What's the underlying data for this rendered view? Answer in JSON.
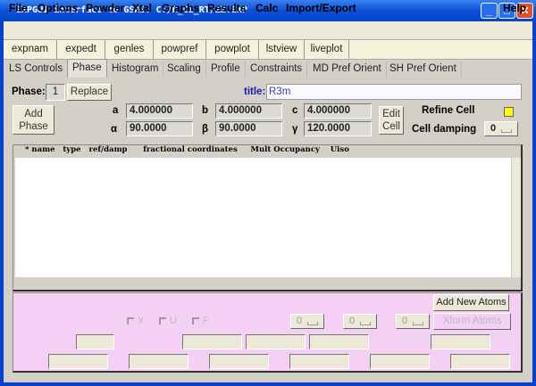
{
  "window": {
    "title": "EXPGUI interface to GSAS: C:/R_C1_RT/ZZ.EXP"
  },
  "menu": [
    "File",
    "Options",
    "Powder",
    "Xtal",
    "Graphs",
    "Results",
    "Calc",
    "Import/Export"
  ],
  "menu_help": "Help",
  "toolbar": [
    "expnam",
    "expedt",
    "genles",
    "powpref",
    "powplot",
    "lstview",
    "liveplot"
  ],
  "tabs": [
    "LS Controls",
    "Phase",
    "Histogram",
    "Scaling",
    "Profile",
    "Constraints",
    "MD Pref Orient",
    "SH Pref Orient"
  ],
  "phase": {
    "label": "Phase:",
    "number": "1",
    "replace": "Replace",
    "title_label": "title:",
    "title_value": "R3m",
    "add_phase": "Add Phase",
    "edit_cell": "Edit Cell",
    "a_label": "a",
    "a": "4.000000",
    "b_label": "b",
    "b": "4.000000",
    "c_label": "c",
    "c": "4.000000",
    "alpha_label": "α",
    "alpha": "90.0000",
    "beta_label": "β",
    "beta": "90.0000",
    "gamma_label": "γ",
    "gamma": "120.0000",
    "refine_cell": "Refine Cell",
    "refine_color": "#ffff00",
    "cell_damping": "Cell damping",
    "damping_value": "0"
  },
  "atoms": {
    "header": "* name   type   ref/damp      fractional coordinates     Mult Occupancy    Uiso"
  },
  "edit": {
    "add_new_atoms": "Add New Atoms",
    "xform_atoms": "Xform Atoms",
    "x": "X",
    "u": "U",
    "f": "F",
    "dd1": "0",
    "dd2": "0",
    "dd3": "0"
  }
}
